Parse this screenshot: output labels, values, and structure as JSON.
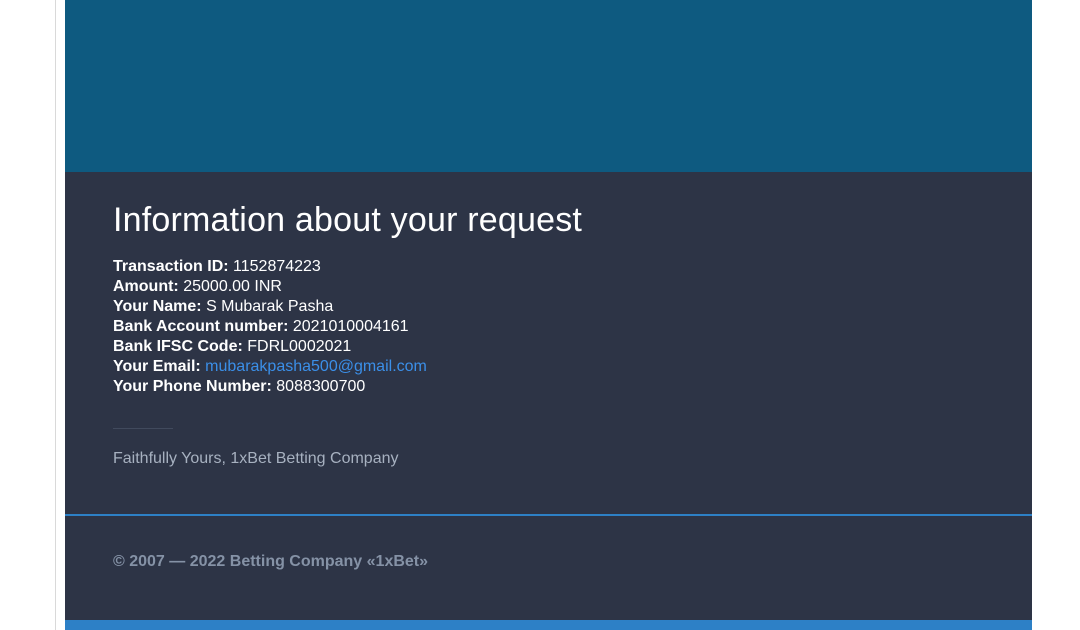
{
  "request_info": {
    "title": "Information about your request",
    "transaction_id_label": "Transaction ID:",
    "transaction_id_value": "1152874223",
    "amount_label": "Amount:",
    "amount_value": "25000.00 INR",
    "name_label": "Your Name:",
    "name_value": "S Mubarak Pasha",
    "account_label": "Bank Account number:",
    "account_value": "2021010004161",
    "ifsc_label": "Bank IFSC Code:",
    "ifsc_value": "FDRL0002021",
    "email_label": "Your Email:",
    "email_value": "mubarakpasha500@gmail.com",
    "phone_label": "Your Phone Number:",
    "phone_value": "8088300700"
  },
  "signature": "Faithfully Yours, 1xBet Betting Company",
  "footer": {
    "copyright": "© 2007 — 2022 Betting Company «1xBet»"
  },
  "colors": {
    "banner": "#0e5a80",
    "card_background": "#2d3446",
    "accent": "#2d80c6",
    "link": "#3b8fe8"
  }
}
